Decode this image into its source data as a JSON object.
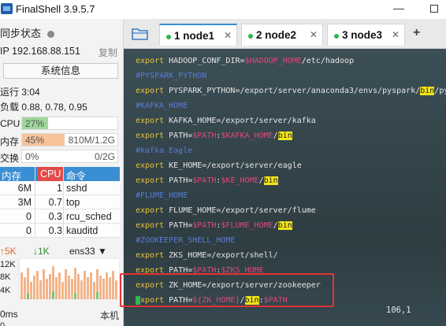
{
  "titlebar": {
    "title": "FinalShell 3.9.5.7",
    "minimize": "—"
  },
  "sidebar": {
    "sync_status": "同步状态",
    "ip": "IP 192.168.88.151",
    "copy": "复制",
    "sysinfo_button": "系统信息",
    "uptime": "运行 3:04",
    "load": "负载 0.88, 0.78, 0.95",
    "cpu": {
      "label": "CPU",
      "value": "27%",
      "fraction": 0.27,
      "color": "#9fd89a"
    },
    "mem": {
      "label": "内存",
      "value": "45%",
      "extra": "810M/1.2G",
      "fraction": 0.45,
      "color": "#f7c39a"
    },
    "swap": {
      "label": "交换",
      "value": "0%",
      "extra": "0/2G",
      "fraction": 0.0,
      "color": "#ffffff"
    },
    "proc_headers": {
      "mem": "内存",
      "cpu": "CPU",
      "cmd": "命令"
    },
    "processes": [
      {
        "mem": "6M",
        "cpu": "1",
        "cmd": "sshd"
      },
      {
        "mem": "3M",
        "cpu": "0.7",
        "cmd": "top"
      },
      {
        "mem": "0",
        "cpu": "0.3",
        "cmd": "rcu_sched"
      },
      {
        "mem": "0",
        "cpu": "0.3",
        "cmd": "kauditd"
      }
    ],
    "net": {
      "up": "5K",
      "down": "1K",
      "iface": "ens33",
      "axis": [
        "12K",
        "8K",
        "4K"
      ]
    },
    "ping": {
      "value": "0ms",
      "target": "本机",
      "zero": "0"
    }
  },
  "tabs": [
    {
      "label": "1 node1",
      "active": true
    },
    {
      "label": "2 node2",
      "active": false
    },
    {
      "label": "3 node3",
      "active": false
    }
  ],
  "terminal": {
    "lines": [
      [
        [
          "kw",
          "export "
        ],
        [
          "txt",
          "HADOOP_CONF_DIR="
        ],
        [
          "var",
          "$HADOOP_HOME"
        ],
        [
          "txt",
          "/etc/hadoop"
        ]
      ],
      [
        [
          "cmt",
          "#PYSPARK_PYTHON"
        ]
      ],
      [
        [
          "kw",
          "export "
        ],
        [
          "txt",
          "PYSPARK_PYTHON=/export/server/anaconda3/envs/pyspark/"
        ],
        [
          "hl",
          "bin"
        ],
        [
          "txt",
          "/pyt"
        ]
      ],
      [
        [
          "cmt",
          "#KAFKA_HOME"
        ]
      ],
      [
        [
          "kw",
          "export "
        ],
        [
          "txt",
          "KAFKA_HOME=/export/server/kafka"
        ]
      ],
      [
        [
          "kw",
          "export "
        ],
        [
          "txt",
          "PATH="
        ],
        [
          "var",
          "$PATH"
        ],
        [
          "txt",
          ":"
        ],
        [
          "var",
          "$KAFKA_HOME"
        ],
        [
          "txt",
          "/"
        ],
        [
          "hl",
          "bin"
        ]
      ],
      [
        [
          "cmt",
          "#kafka Eagle"
        ]
      ],
      [
        [
          "kw",
          "export "
        ],
        [
          "txt",
          "KE_HOME=/export/server/eagle"
        ]
      ],
      [
        [
          "kw",
          "export "
        ],
        [
          "txt",
          "PATH="
        ],
        [
          "var",
          "$PATH"
        ],
        [
          "txt",
          ":"
        ],
        [
          "var",
          "$KE_HOME"
        ],
        [
          "txt",
          "/"
        ],
        [
          "hl",
          "bin"
        ]
      ],
      [
        [
          "cmt",
          "#FLUME_HOME"
        ]
      ],
      [
        [
          "kw",
          "export "
        ],
        [
          "txt",
          "FLUME_HOME=/export/server/flume"
        ]
      ],
      [
        [
          "kw",
          "export "
        ],
        [
          "txt",
          "PATH="
        ],
        [
          "var",
          "$PATH"
        ],
        [
          "txt",
          ":"
        ],
        [
          "var",
          "$FLUME_HOME"
        ],
        [
          "txt",
          "/"
        ],
        [
          "hl",
          "bin"
        ]
      ],
      [
        [
          "cmt",
          "#ZOOKEEPER_SHELL_HOME"
        ]
      ],
      [
        [
          "kw",
          "export "
        ],
        [
          "txt",
          "ZKS_HOME=/export/shell/"
        ]
      ],
      [
        [
          "kw",
          "export "
        ],
        [
          "txt",
          "PATH="
        ],
        [
          "var",
          "$PATH"
        ],
        [
          "txt",
          ":"
        ],
        [
          "var",
          "$ZKS_HOME"
        ]
      ],
      [
        [
          "kw",
          "export "
        ],
        [
          "txt",
          "ZK_HOME=/export/server/zookeeper"
        ]
      ],
      [
        [
          "cur",
          "e"
        ],
        [
          "kw",
          "xport "
        ],
        [
          "txt",
          "PATH="
        ],
        [
          "var",
          "${ZK_HOME}"
        ],
        [
          "txt",
          "/"
        ],
        [
          "hl",
          "bin"
        ],
        [
          "txt",
          ":"
        ],
        [
          "var",
          "$PATH"
        ]
      ]
    ],
    "position": "106,1"
  }
}
